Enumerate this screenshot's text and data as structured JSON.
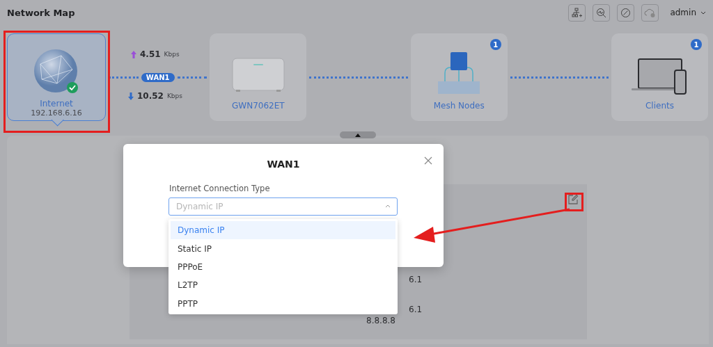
{
  "header": {
    "title": "Network Map",
    "user": "admin"
  },
  "nodes": [
    {
      "kind": "internet",
      "label": "Internet",
      "address": "192.168.6.16",
      "selected": true,
      "connected": true
    },
    {
      "kind": "router",
      "label": "GWN7062ET",
      "selected": false
    },
    {
      "kind": "mesh",
      "label": "Mesh Nodes",
      "badge": "1",
      "selected": false
    },
    {
      "kind": "clients",
      "label": "Clients",
      "badge": "1",
      "selected": false
    }
  ],
  "link": {
    "upload": "4.51",
    "upload_unit": "Kbps",
    "port": "WAN1",
    "download": "10.52",
    "download_unit": "Kbps"
  },
  "background_values": [
    {
      "text": "6.1"
    },
    {
      "text": "6.1"
    },
    {
      "text": "8.8.8.8"
    }
  ],
  "dialog": {
    "title": "WAN1",
    "field_label": "Internet Connection Type",
    "placeholder": "Dynamic IP",
    "expanded": true,
    "options": [
      {
        "label": "Dynamic IP",
        "selected": true
      },
      {
        "label": "Static IP",
        "selected": false
      },
      {
        "label": "PPPoE",
        "selected": false
      },
      {
        "label": "L2TP",
        "selected": false
      },
      {
        "label": "PPTP",
        "selected": false
      }
    ]
  }
}
